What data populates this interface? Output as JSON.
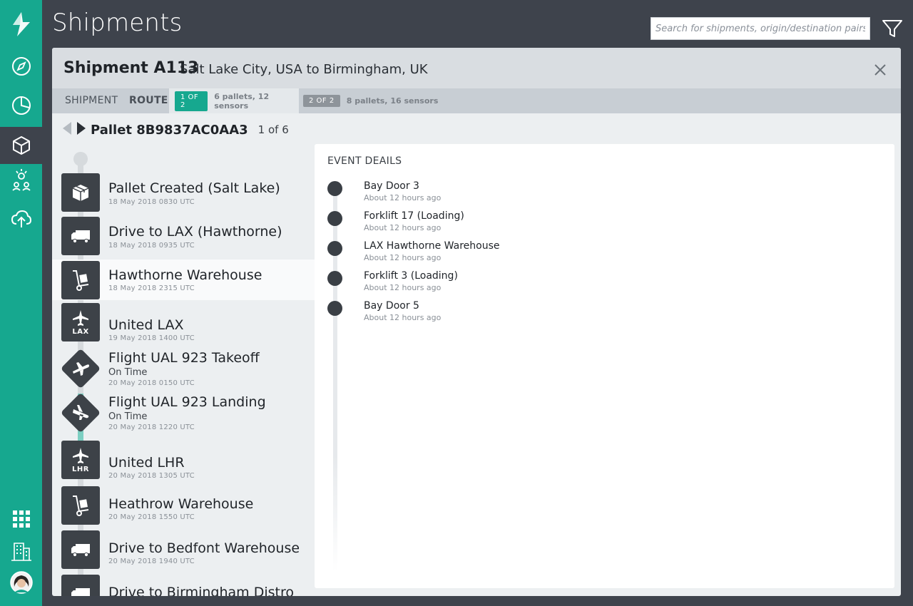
{
  "app": {
    "page_title": "Shipments",
    "colors": {
      "brand": "#16a88f",
      "dark": "#3e434c"
    }
  },
  "nav": {
    "items": [
      {
        "name": "logo",
        "icon": "leaf-logo-icon"
      },
      {
        "name": "explore",
        "icon": "compass-icon"
      },
      {
        "name": "analytics",
        "icon": "pie-chart-icon"
      },
      {
        "name": "shipments",
        "icon": "box-icon",
        "active": true
      },
      {
        "name": "sensors",
        "icon": "sensor-network-icon"
      },
      {
        "name": "upload",
        "icon": "cloud-upload-icon"
      },
      {
        "name": "apps",
        "icon": "grid-icon"
      },
      {
        "name": "facilities",
        "icon": "building-icon"
      },
      {
        "name": "profile",
        "icon": "avatar-icon"
      }
    ]
  },
  "search": {
    "placeholder": "Search for shipments, origin/destination pairs, etc"
  },
  "shipment": {
    "title": "Shipment A113",
    "route": "Salt Lake City, USA to Birmingham, UK",
    "tabs": {
      "shipment": "SHIPMENT",
      "route": "ROUTE"
    },
    "segments": [
      {
        "label": "1 OF 2",
        "note": "6 pallets, 12 sensors",
        "active": true
      },
      {
        "label": "2 OF 2",
        "note": "8 pallets, 16 sensors",
        "active": false
      }
    ]
  },
  "pallet": {
    "id": "Pallet 8B9837AC0AA3",
    "position": "1 of 6"
  },
  "timeline": [
    {
      "name": "Pallet Created (Salt Lake)",
      "time": "18 May 2018  0830 UTC",
      "icon": "box-icon"
    },
    {
      "name": "Drive to LAX (Hawthorne)",
      "time": "18 May 2018 0935 UTC",
      "icon": "truck-icon"
    },
    {
      "name": "Hawthorne Warehouse",
      "time": "18 May 2018 2315 UTC",
      "icon": "hand-truck-icon"
    },
    {
      "name": "United LAX",
      "time": "19 May 2018 1400 UTC",
      "icon": "airport-icon",
      "code": "LAX"
    },
    {
      "name": "Flight UAL 923 Takeoff",
      "status": "On Time",
      "time": "20 May 2018 0150 UTC",
      "icon": "plane-takeoff-icon"
    },
    {
      "name": "Flight UAL 923 Landing",
      "status": "On Time",
      "time": "20 May 2018 1220 UTC",
      "icon": "plane-landing-icon"
    },
    {
      "name": "United LHR",
      "time": "20 May 2018 1305 UTC",
      "icon": "airport-icon",
      "code": "LHR"
    },
    {
      "name": "Heathrow Warehouse",
      "time": "20 May 2018 1550 UTC",
      "icon": "hand-truck-icon"
    },
    {
      "name": "Drive to Bedfont Warehouse",
      "time": "20 May 2018 1940 UTC",
      "icon": "truck-icon"
    },
    {
      "name": "Drive to Birmingham Distro",
      "time": "",
      "icon": "truck-icon"
    }
  ],
  "events": {
    "title": "EVENT DEAILS",
    "items": [
      {
        "name": "Bay Door 3",
        "time": "About 12 hours ago"
      },
      {
        "name": "Forklift 17 (Loading)",
        "time": "About 12 hours ago"
      },
      {
        "name": "LAX Hawthorne Warehouse",
        "time": "About 12 hours ago"
      },
      {
        "name": "Forklift 3 (Loading)",
        "time": "About 12 hours ago"
      },
      {
        "name": "Bay Door 5",
        "time": "About 12 hours ago"
      }
    ]
  }
}
